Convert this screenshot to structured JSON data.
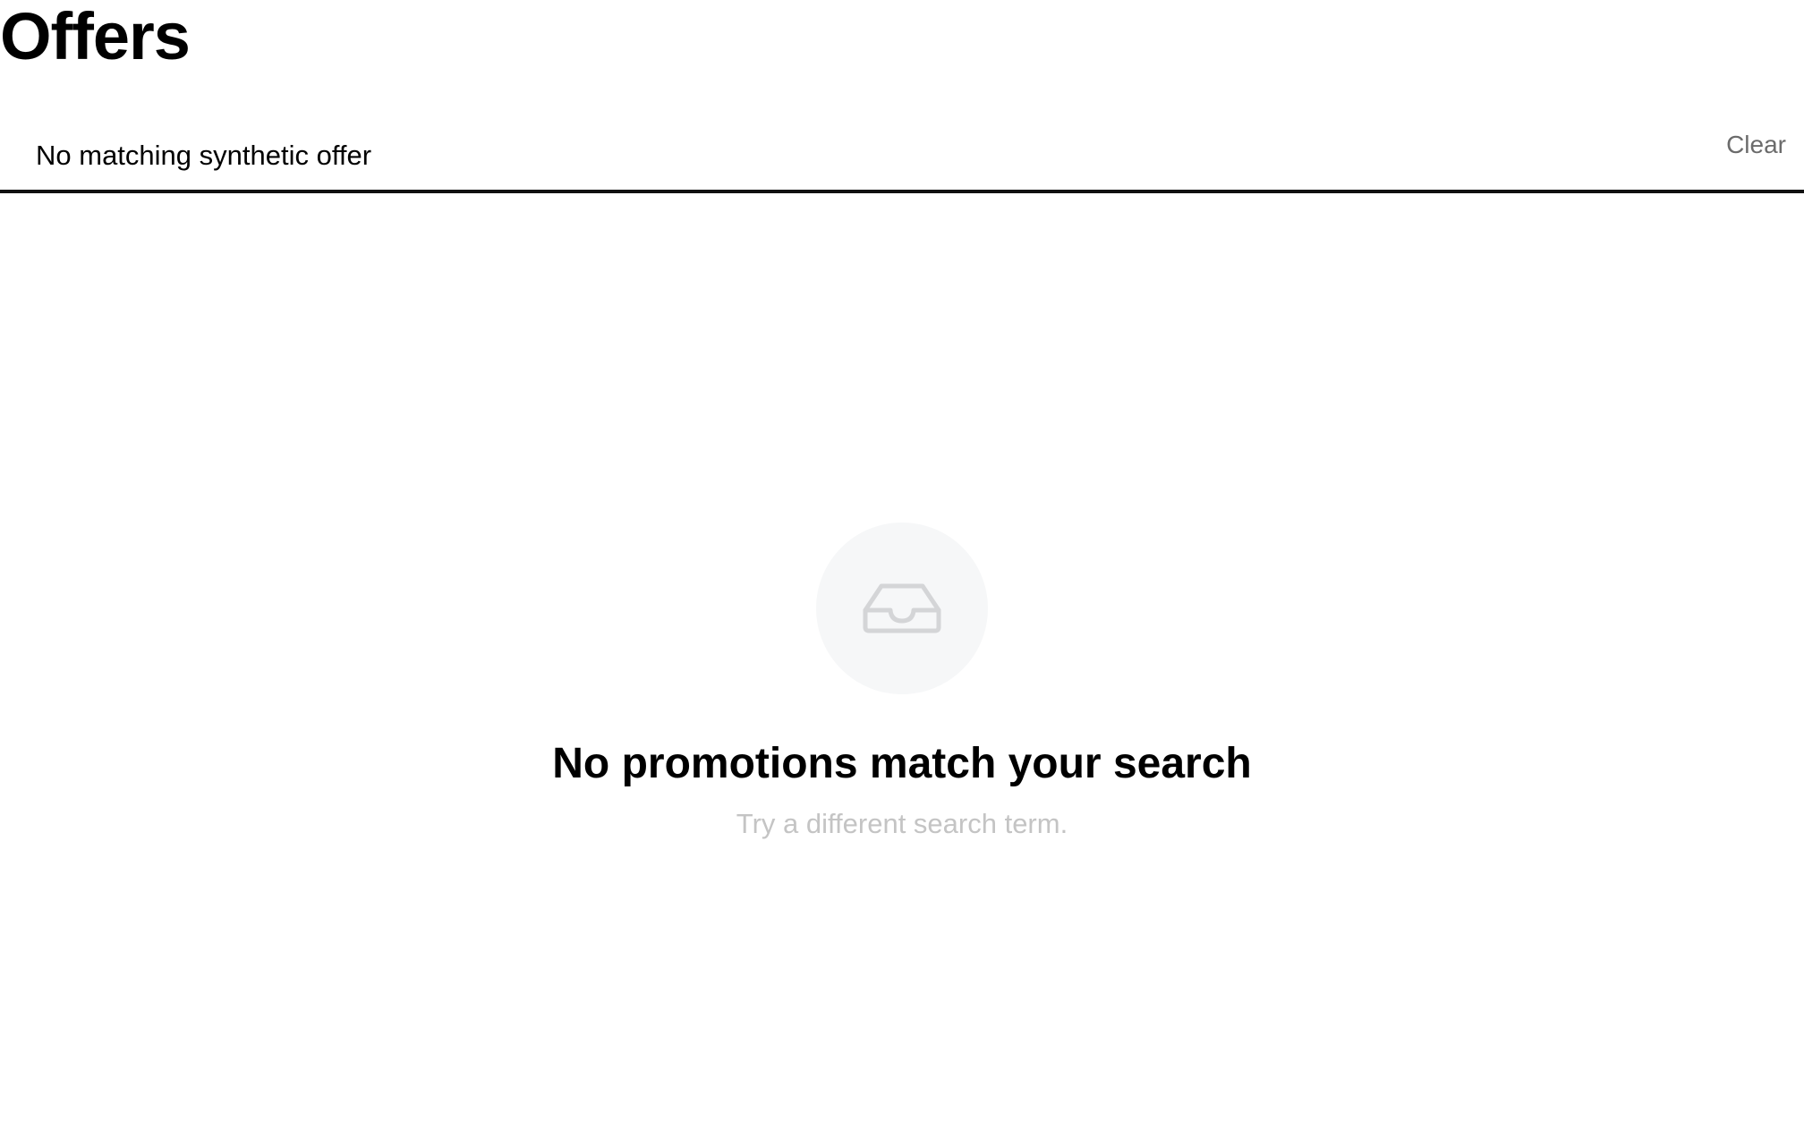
{
  "page": {
    "title": "Offers"
  },
  "search": {
    "value": "No matching synthetic offer",
    "clear_label": "Clear"
  },
  "empty_state": {
    "icon": "inbox-icon",
    "title": "No promotions match your search",
    "subtitle": "Try a different search term."
  },
  "colors": {
    "icon_circle_bg": "#f6f7f8",
    "icon_stroke": "#d4d5d7",
    "subtitle_text": "#c4c4c4",
    "clear_text": "#6b6b6b",
    "divider": "#111111"
  }
}
